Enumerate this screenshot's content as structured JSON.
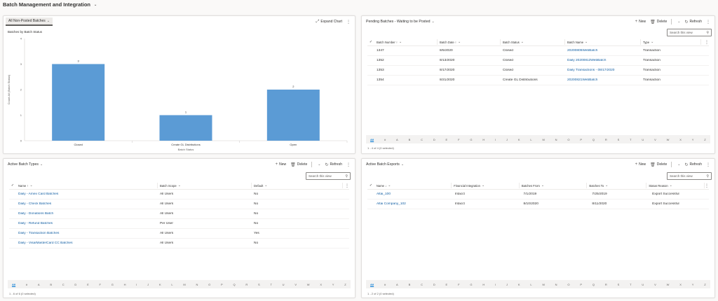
{
  "page": {
    "title": "Batch Management and Integration"
  },
  "chart_panel": {
    "view_name": "All Non-Posted Batches",
    "expand_label": "Expand Chart",
    "subtitle": "Batches by Batch Status",
    "chart_data": {
      "type": "bar",
      "title": "Batches by Batch Status",
      "xlabel": "Batch Status",
      "ylabel": "Count:All (Batch Status)",
      "categories": [
        "Closed",
        "Create GL Distributions",
        "Open"
      ],
      "values": [
        3,
        1,
        2
      ],
      "ylim": [
        0,
        4
      ],
      "yticks": [
        "0",
        "1",
        "2",
        "3",
        "4"
      ],
      "value_labels": [
        "3",
        "1",
        "2"
      ],
      "bar_color": "#5b9bd5",
      "grid": false
    }
  },
  "pending": {
    "title": "Pending Batches - Waiting to be Posted",
    "new_label": "New",
    "delete_label": "Delete",
    "refresh_label": "Refresh",
    "search_placeholder": "Search this view",
    "columns": [
      "Batch Number ↑",
      "Batch Date ↑",
      "Batch Status",
      "Batch Name",
      "Type"
    ],
    "rows": [
      [
        "1347",
        "8/5/2020",
        "Closed",
        "20200805WebBatch",
        "Transaction"
      ],
      [
        "1352",
        "8/13/2020",
        "Closed",
        "Daily 20200813WebBatch",
        "Transaction"
      ],
      [
        "1353",
        "8/17/2020",
        "Closed",
        "Daily Transactions - 08/17/2020",
        "Transaction"
      ],
      [
        "1354",
        "8/21/2020",
        "Create GL Distributions",
        "20200821WebBatch",
        "Transaction"
      ]
    ],
    "count_text": "1 - 4 of 4 (0 selected)"
  },
  "types": {
    "title": "Active Batch Types",
    "new_label": "New",
    "delete_label": "Delete",
    "refresh_label": "Refresh",
    "search_placeholder": "Search this view",
    "columns": [
      "Name ↑",
      "Batch Scope",
      "Default"
    ],
    "rows": [
      [
        "Daily - Amex Card Batches",
        "All Users",
        "No"
      ],
      [
        "Daily - Check Batches",
        "All Users",
        "No"
      ],
      [
        "Daily - Donations Batch",
        "All Users",
        "No"
      ],
      [
        "Daily - Refund Batches",
        "Per User",
        "No"
      ],
      [
        "Daily - Transaction Batches",
        "All Users",
        "Yes"
      ],
      [
        "Daily - Visa/MasterCard CC Batches",
        "All Users",
        "No"
      ]
    ],
    "count_text": "1 - 6 of 6 (0 selected)"
  },
  "exports": {
    "title": "Active Batch Exports",
    "new_label": "New",
    "delete_label": "Delete",
    "refresh_label": "Refresh",
    "search_placeholder": "Search this view",
    "columns": [
      "Name ↓",
      "Financial Integration",
      "Batches From",
      "Batches To",
      "Status Reason"
    ],
    "rows": [
      [
        "Altai_100",
        "Intacct",
        "7/1/2019",
        "7/25/2019",
        "Export Successful"
      ],
      [
        "Altai Company_102",
        "Intacct",
        "8/10/2020",
        "8/11/2020",
        "Export Successful"
      ]
    ],
    "count_text": "1 - 2 of 2 (0 selected)"
  },
  "alphabet": [
    "All",
    "#",
    "A",
    "B",
    "C",
    "D",
    "E",
    "F",
    "G",
    "H",
    "I",
    "J",
    "K",
    "L",
    "M",
    "N",
    "O",
    "P",
    "Q",
    "R",
    "S",
    "T",
    "U",
    "V",
    "W",
    "X",
    "Y",
    "Z"
  ]
}
